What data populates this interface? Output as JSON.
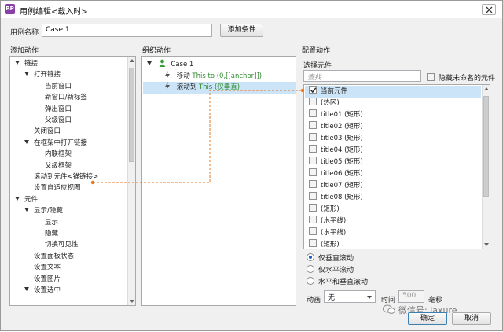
{
  "window": {
    "title": "用例编辑<载入时>"
  },
  "case_name": {
    "label": "用例名称",
    "value": "Case 1",
    "add_condition": "添加条件"
  },
  "sections": {
    "add_action": "添加动作",
    "organize_action": "组织动作",
    "configure_action": "配置动作"
  },
  "add_action_tree": [
    {
      "label": "链接",
      "level": 0,
      "expander": true
    },
    {
      "label": "打开链接",
      "level": 1,
      "expander": true
    },
    {
      "label": "当前窗口",
      "level": 3
    },
    {
      "label": "新窗口/新标签",
      "level": 3
    },
    {
      "label": "弹出窗口",
      "level": 3
    },
    {
      "label": "父级窗口",
      "level": 3
    },
    {
      "label": "关闭窗口",
      "level": 1
    },
    {
      "label": "在框架中打开链接",
      "level": 1,
      "expander": true
    },
    {
      "label": "内联框架",
      "level": 3
    },
    {
      "label": "父级框架",
      "level": 3
    },
    {
      "label": "滚动到元件<锚链接>",
      "level": 1
    },
    {
      "label": "设置自适应视图",
      "level": 1
    },
    {
      "label": "元件",
      "level": 0,
      "expander": true
    },
    {
      "label": "显示/隐藏",
      "level": 1,
      "expander": true
    },
    {
      "label": "显示",
      "level": 3
    },
    {
      "label": "隐藏",
      "level": 3
    },
    {
      "label": "切换可见性",
      "level": 3
    },
    {
      "label": "设置面板状态",
      "level": 1
    },
    {
      "label": "设置文本",
      "level": 1
    },
    {
      "label": "设置图片",
      "level": 1
    },
    {
      "label": "设置选中",
      "level": 1,
      "expander": true
    }
  ],
  "organize": {
    "case_label": "Case 1",
    "actions": [
      {
        "prefix": "移动",
        "detail": "This to (0,[[anchor]])"
      },
      {
        "prefix": "滚动到",
        "detail": "This (仅垂直)"
      }
    ]
  },
  "configure": {
    "select_widget_label": "选择元件",
    "search_placeholder": "查找",
    "hide_unnamed_label": "隐藏未命名的元件",
    "widgets": [
      {
        "label": "当前元件",
        "checked": true
      },
      {
        "label": "(热区)",
        "checked": false
      },
      {
        "label": "title01 (矩形)",
        "checked": false
      },
      {
        "label": "title02 (矩形)",
        "checked": false
      },
      {
        "label": "title03 (矩形)",
        "checked": false
      },
      {
        "label": "title04 (矩形)",
        "checked": false
      },
      {
        "label": "title05 (矩形)",
        "checked": false
      },
      {
        "label": "title06 (矩形)",
        "checked": false
      },
      {
        "label": "title07 (矩形)",
        "checked": false
      },
      {
        "label": "title08 (矩形)",
        "checked": false
      },
      {
        "label": "(矩形)",
        "checked": false
      },
      {
        "label": "(水平线)",
        "checked": false
      },
      {
        "label": "(水平线)",
        "checked": false
      },
      {
        "label": "(矩形)",
        "checked": false
      }
    ],
    "scroll_options": [
      {
        "label": "仅垂直滚动",
        "selected": true
      },
      {
        "label": "仅水平滚动",
        "selected": false
      },
      {
        "label": "水平和垂直滚动",
        "selected": false
      }
    ],
    "animation_label": "动画",
    "animation_value": "无",
    "time_label": "时间",
    "time_value": "500",
    "time_unit": "毫秒"
  },
  "buttons": {
    "ok": "确定",
    "cancel": "取消"
  },
  "watermark": "微信号: iaxure"
}
